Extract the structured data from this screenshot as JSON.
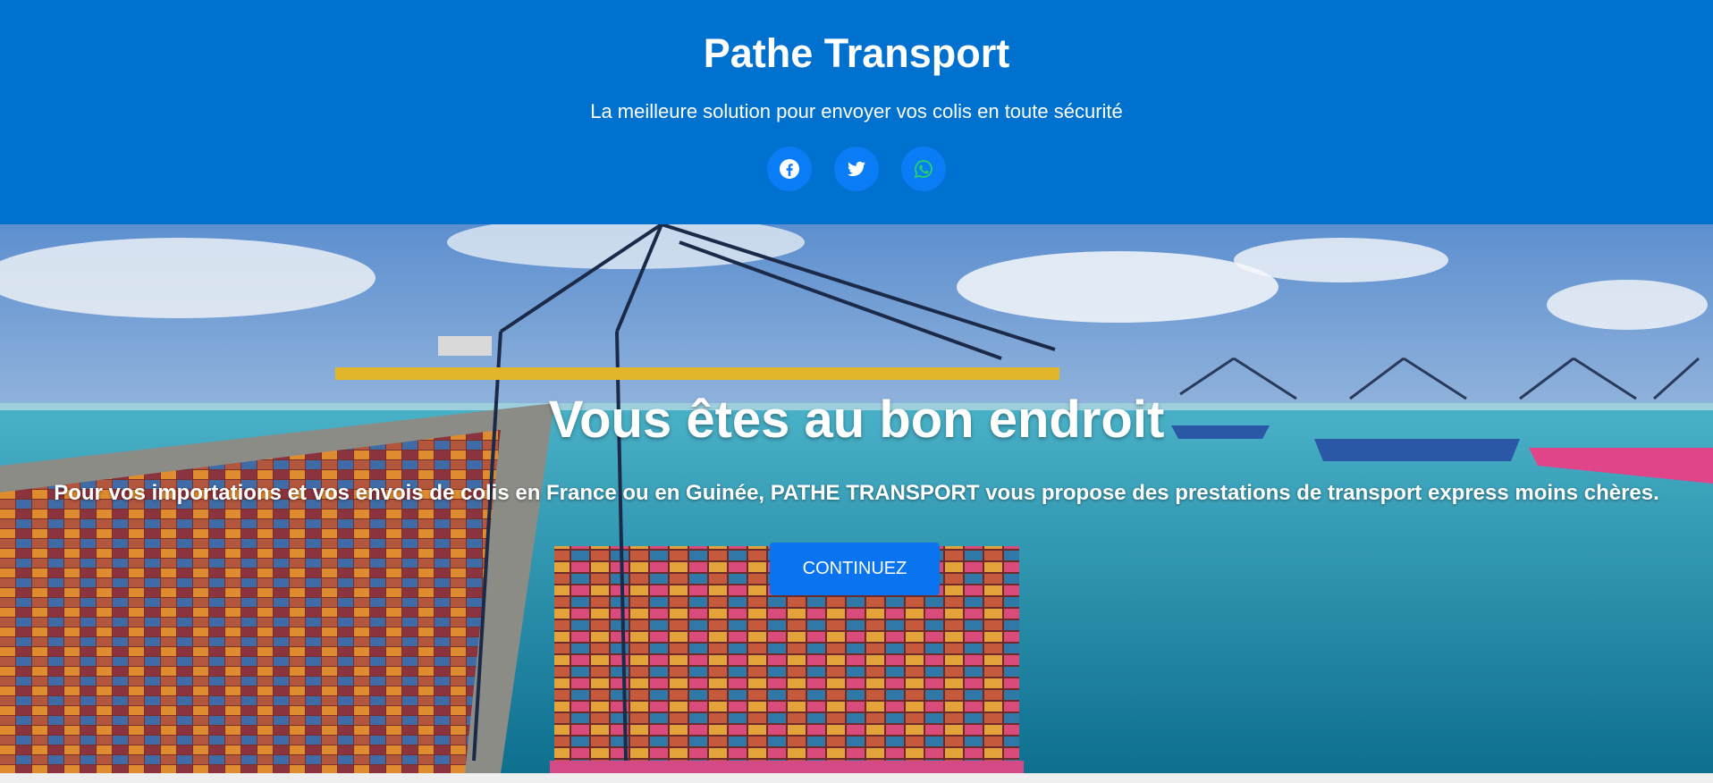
{
  "header": {
    "title": "Pathe Transport",
    "tagline": "La meilleure solution pour envoyer vos colis en toute sécurité",
    "socials": [
      {
        "name": "facebook-icon",
        "color": "#ffffff"
      },
      {
        "name": "twitter-icon",
        "color": "#ffffff"
      },
      {
        "name": "whatsapp-icon",
        "color": "#25d366"
      }
    ],
    "bg_color": "#0071ce"
  },
  "hero": {
    "title": "Vous êtes au bon endroit",
    "text_before": "Pour vos importations et vos envois de colis en France ou en Guinée, ",
    "brand": "PATHE TRANSPORT",
    "text_after": " vous propose des prestations de transport express moins chères.",
    "cta_label": "CONTINUEZ",
    "cta_color": "#0a74f0"
  }
}
